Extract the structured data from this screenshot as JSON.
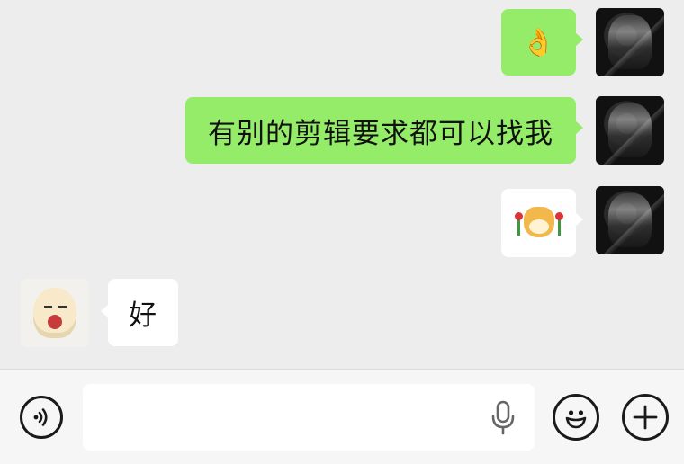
{
  "messages": [
    {
      "side": "out",
      "type": "emoji",
      "content": "👌"
    },
    {
      "side": "out",
      "type": "text",
      "content": "有别的剪辑要求都可以找我"
    },
    {
      "side": "out",
      "type": "sticker",
      "sticker": "doge-with-roses"
    },
    {
      "side": "in",
      "type": "text",
      "content": "好"
    }
  ],
  "input": {
    "value": "",
    "placeholder": ""
  },
  "icons": {
    "voice": "voice-toggle-icon",
    "mic": "microphone-icon",
    "emoji": "emoji-smiley-icon",
    "more": "plus-icon"
  },
  "colors": {
    "background": "#ededed",
    "outgoing_bubble": "#95ec69",
    "incoming_bubble": "#ffffff",
    "input_bar": "#f6f6f6"
  }
}
